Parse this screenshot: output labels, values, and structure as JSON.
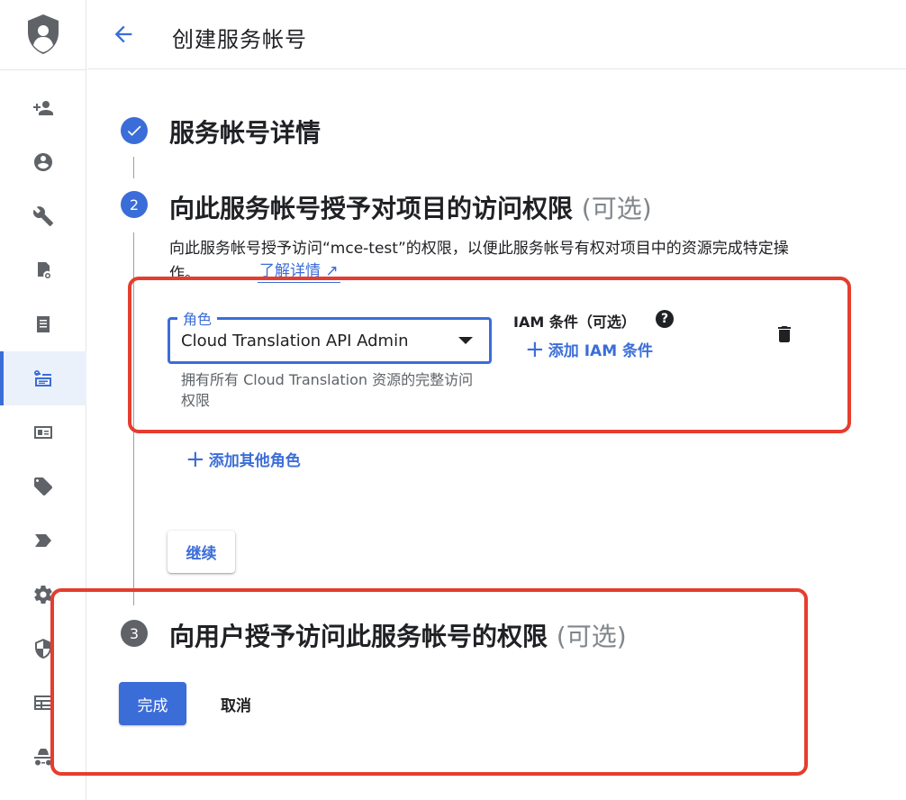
{
  "header": {
    "title": "创建服务帐号"
  },
  "sidebar": {
    "items": [
      {
        "icon": "add-person-icon"
      },
      {
        "icon": "account-circle-icon"
      },
      {
        "icon": "wrench-icon"
      },
      {
        "icon": "audit-document-icon"
      },
      {
        "icon": "list-document-icon"
      },
      {
        "icon": "service-account-icon",
        "active": true
      },
      {
        "icon": "id-card-icon"
      },
      {
        "icon": "tag-icon"
      },
      {
        "icon": "label-arrow-icon"
      },
      {
        "icon": "gear-icon"
      },
      {
        "icon": "shield-icon"
      },
      {
        "icon": "table-icon"
      },
      {
        "icon": "spy-icon"
      }
    ]
  },
  "steps": {
    "step1": {
      "title": "服务帐号详情"
    },
    "step2": {
      "number": "2",
      "title": "向此服务帐号授予对项目的访问权限",
      "optional": "(可选)",
      "description": "向此服务帐号授予访问“mce-test”的权限，以便此服务帐号有权对项目中的资源完成特定操作。",
      "learn_more": "了解详情 ↗"
    },
    "step3": {
      "number": "3",
      "title": "向用户授予访问此服务帐号的权限",
      "optional": "(可选)"
    }
  },
  "role": {
    "label": "角色",
    "value": "Cloud Translation API Admin",
    "help": "拥有所有 Cloud Translation 资源的完整访问权限"
  },
  "iam": {
    "label": "IAM 条件（可选）",
    "add_label": "添加 IAM 条件"
  },
  "actions": {
    "add_role": "添加其他角色",
    "continue": "继续",
    "done": "完成",
    "cancel": "取消"
  },
  "colors": {
    "accent": "#3b6dd8",
    "highlight": "#e53d2f"
  }
}
